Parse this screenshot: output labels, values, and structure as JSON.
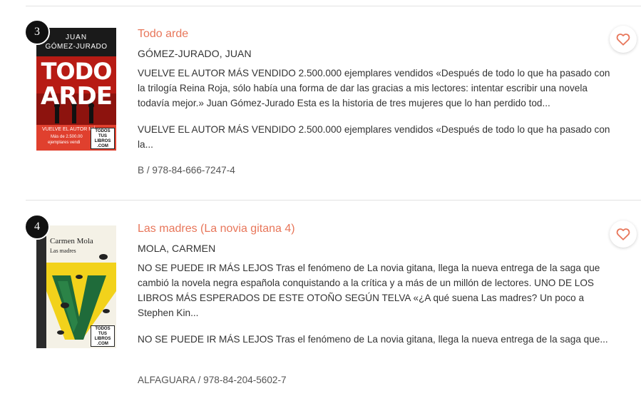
{
  "results": [
    {
      "rank": "3",
      "title": "Todo arde",
      "author": "GÓMEZ-JURADO, JUAN",
      "desc_long": "VUELVE EL AUTOR MÁS VENDIDO 2.500.000 ejemplares vendidos «Después de todo lo que ha pasado con la trilogía Reina Roja, sólo había una forma de dar las gracias a mis lectores: intentar escribir una novela todavía mejor.» Juan Gómez-Jurado Esta es la historia de tres mujeres que lo han perdido tod...",
      "desc_short": "VUELVE EL AUTOR MÁS VENDIDO 2.500.000 ejemplares vendidos «Después de todo lo que ha pasado con la...",
      "meta": "B / 978-84-666-7247-4",
      "cover": {
        "author_top": "JUAN",
        "author_bottom": "GÓMEZ-JURADO",
        "title_line1": "TODO",
        "title_line2": "ARDE",
        "band_line1": "VUELVE EL AUTOR MÁ",
        "band_line2": "Más de 2.500.00",
        "band_line3": "ejemplares vendi",
        "badge": [
          "TODOS",
          "TUS",
          "LIBROS",
          ".COM"
        ],
        "colors": {
          "bg": "#c8221a",
          "dark": "#1a1a1a",
          "band": "#e0402e"
        }
      }
    },
    {
      "rank": "4",
      "title": "Las madres (La novia gitana 4)",
      "author": "MOLA, CARMEN",
      "desc_long": "NO SE PUEDE IR MÁS LEJOS Tras el fenómeno de La novia gitana, llega la nueva entrega de la saga que cambió la novela negra española conquistando a la crítica y a más de un millón de lectores. UNO DE LOS LIBROS MÁS ESPERADOS DE ESTE OTOÑO SEGÚN TELVA «¿A qué suena Las madres? Un poco a Stephen Kin...",
      "desc_short": "NO SE PUEDE IR MÁS LEJOS Tras el fenómeno de La novia gitana, llega la nueva entrega de la saga que...",
      "meta": "ALFAGUARA / 978-84-204-5602-7",
      "cover": {
        "author": "Carmen Mola",
        "title": "Las madres",
        "badge": [
          "TODOS",
          "TUS",
          "LIBROS",
          ".COM"
        ],
        "colors": {
          "bg": "#f4f1e6",
          "yellow": "#f2d21b",
          "green": "#1f6b3a",
          "dark": "#222222"
        }
      }
    }
  ],
  "icons": {
    "favorite": "heart-outline-icon"
  },
  "colors": {
    "accent": "#e8765a",
    "heart": "#e8765a"
  }
}
